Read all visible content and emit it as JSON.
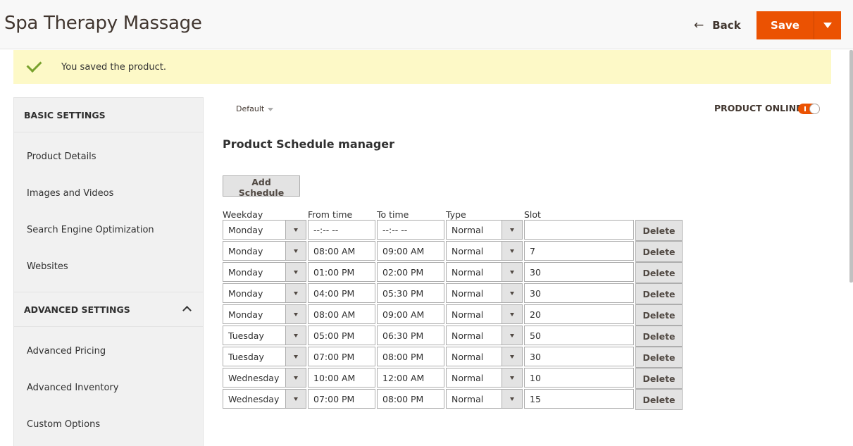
{
  "header": {
    "title": "Spa Therapy Massage",
    "back_arrow": "←",
    "back_label": "Back",
    "save_label": "Save"
  },
  "message": {
    "text": "You saved the product."
  },
  "sidebar": {
    "basic_heading": "BASIC SETTINGS",
    "basic_items": [
      "Product Details",
      "Images and Videos",
      "Search Engine Optimization",
      "Websites"
    ],
    "advanced_heading": "ADVANCED SETTINGS",
    "advanced_items": [
      "Advanced Pricing",
      "Advanced Inventory",
      "Custom Options"
    ]
  },
  "scope": {
    "label": "Default"
  },
  "product_online": {
    "label": "PRODUCT ONLINE",
    "enabled": true
  },
  "schedule": {
    "title": "Product Schedule manager",
    "add_label": "Add Schedule",
    "columns": [
      "Weekday",
      "From time",
      "To time",
      "Type",
      "Slot"
    ],
    "delete_label": "Delete",
    "rows": [
      {
        "weekday": "Monday",
        "from": "--:-- --",
        "to": "--:-- --",
        "type": "Normal",
        "slot": ""
      },
      {
        "weekday": "Monday",
        "from": "08:00 AM",
        "to": "09:00 AM",
        "type": "Normal",
        "slot": "7"
      },
      {
        "weekday": "Monday",
        "from": "01:00 PM",
        "to": "02:00 PM",
        "type": "Normal",
        "slot": "30"
      },
      {
        "weekday": "Monday",
        "from": "04:00 PM",
        "to": "05:30 PM",
        "type": "Normal",
        "slot": "30"
      },
      {
        "weekday": "Monday",
        "from": "08:00 AM",
        "to": "09:00 AM",
        "type": "Normal",
        "slot": "20"
      },
      {
        "weekday": "Tuesday",
        "from": "05:00 PM",
        "to": "06:30 PM",
        "type": "Normal",
        "slot": "50"
      },
      {
        "weekday": "Tuesday",
        "from": "07:00 PM",
        "to": "08:00 PM",
        "type": "Normal",
        "slot": "30"
      },
      {
        "weekday": "Wednesday",
        "from": "10:00 AM",
        "to": "12:00 AM",
        "type": "Normal",
        "slot": "10"
      },
      {
        "weekday": "Wednesday",
        "from": "07:00 PM",
        "to": "08:00 PM",
        "type": "Normal",
        "slot": "15"
      }
    ]
  },
  "colors": {
    "accent": "#eb5202",
    "message_bg": "#fdf9c7",
    "success": "#79a22e"
  }
}
